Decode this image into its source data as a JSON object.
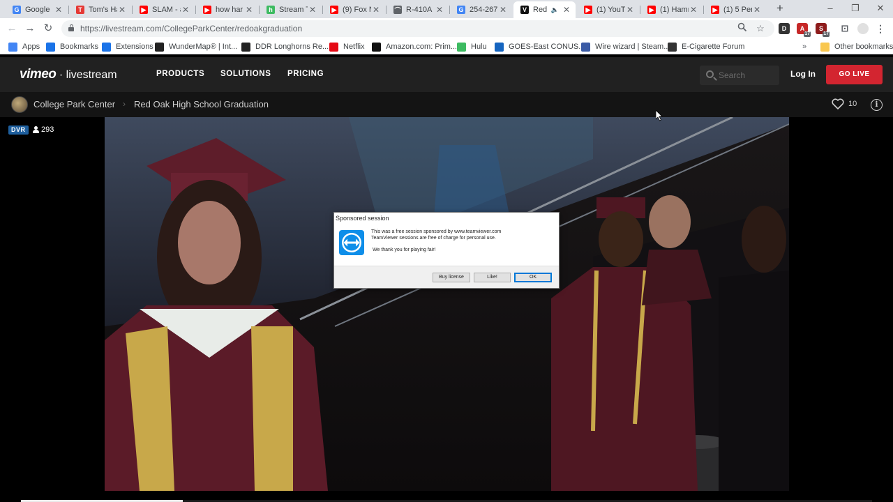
{
  "browser": {
    "tabs": [
      {
        "title": "Google",
        "favicon": "google-icon",
        "color": "#4285f4",
        "glyph": "G"
      },
      {
        "title": "Tom's Ha",
        "favicon": "toms-hardware-icon",
        "color": "#e53935",
        "glyph": "T"
      },
      {
        "title": "SLAM - a",
        "favicon": "youtube-icon",
        "color": "#ff0000",
        "glyph": "▶"
      },
      {
        "title": "how har",
        "favicon": "youtube-icon",
        "color": "#ff0000",
        "glyph": "▶"
      },
      {
        "title": "Stream T",
        "favicon": "hulu-icon",
        "color": "#3dbb61",
        "glyph": "h"
      },
      {
        "title": "(9) Fox N",
        "favicon": "youtube-icon",
        "color": "#ff0000",
        "glyph": "▶"
      },
      {
        "title": "R-410A",
        "favicon": "gauge-icon",
        "color": "#5f6368",
        "glyph": "⌒"
      },
      {
        "title": "254-267",
        "favicon": "google-icon",
        "color": "#4285f4",
        "glyph": "G"
      },
      {
        "title": "Red",
        "favicon": "vimeo-icon",
        "color": "#111111",
        "glyph": "V",
        "active": true,
        "audio": true
      },
      {
        "title": "(1) YouT",
        "favicon": "youtube-icon",
        "color": "#ff0000",
        "glyph": "▶"
      },
      {
        "title": "(1) Hamm",
        "favicon": "youtube-icon",
        "color": "#ff0000",
        "glyph": "▶"
      },
      {
        "title": "(1) 5 Per",
        "favicon": "youtube-icon",
        "color": "#ff0000",
        "glyph": "▶"
      }
    ],
    "url": "https://livestream.com/CollegeParkCenter/redoakgraduation",
    "bookmarks": [
      {
        "label": "Apps",
        "icon": "apps-grid-icon",
        "color": "#4285f4"
      },
      {
        "label": "Bookmarks",
        "icon": "star-icon",
        "color": "#1a73e8"
      },
      {
        "label": "Extensions",
        "icon": "puzzle-icon",
        "color": "#1a73e8"
      },
      {
        "label": "WunderMap® | Int...",
        "icon": "wunderground-icon",
        "color": "#222222"
      },
      {
        "label": "DDR Longhorns Re...",
        "icon": "ddr-icon",
        "color": "#222222"
      },
      {
        "label": "Netflix",
        "icon": "netflix-icon",
        "color": "#e50914"
      },
      {
        "label": "Amazon.com: Prim...",
        "icon": "amazon-icon",
        "color": "#111111"
      },
      {
        "label": "Hulu",
        "icon": "hulu-icon",
        "color": "#3dbb61"
      },
      {
        "label": "GOES-East CONUS...",
        "icon": "noaa-icon",
        "color": "#1565c0"
      },
      {
        "label": "Wire wizard | Steam...",
        "icon": "wire-wizard-icon",
        "color": "#3b5ba5"
      },
      {
        "label": "E-Cigarette Forum",
        "icon": "ecf-icon",
        "color": "#333333"
      }
    ],
    "other_bookmarks": "Other bookmarks",
    "ext_badge": "17"
  },
  "site": {
    "logo_brand": "vimeo",
    "logo_sub": "livestream",
    "nav": [
      "PRODUCTS",
      "SOLUTIONS",
      "PRICING"
    ],
    "search_placeholder": "Search",
    "login": "Log In",
    "go_live": "GO LIVE",
    "accent": "#d32530"
  },
  "event": {
    "channel": "College Park Center",
    "title": "Red Oak High School Graduation",
    "likes": "10",
    "dvr_badge": "DVR",
    "viewers": "293",
    "progress": 0.19
  },
  "dialog": {
    "title": "Sponsored session",
    "line1": "This was a free session sponsored by www.teamviewer.com",
    "line2": "TeamViewer sessions are free of charge for personal use.",
    "line3": "We thank you for playing fair!",
    "buttons": {
      "buy": "Buy license",
      "like": "Like!",
      "ok": "OK"
    }
  }
}
